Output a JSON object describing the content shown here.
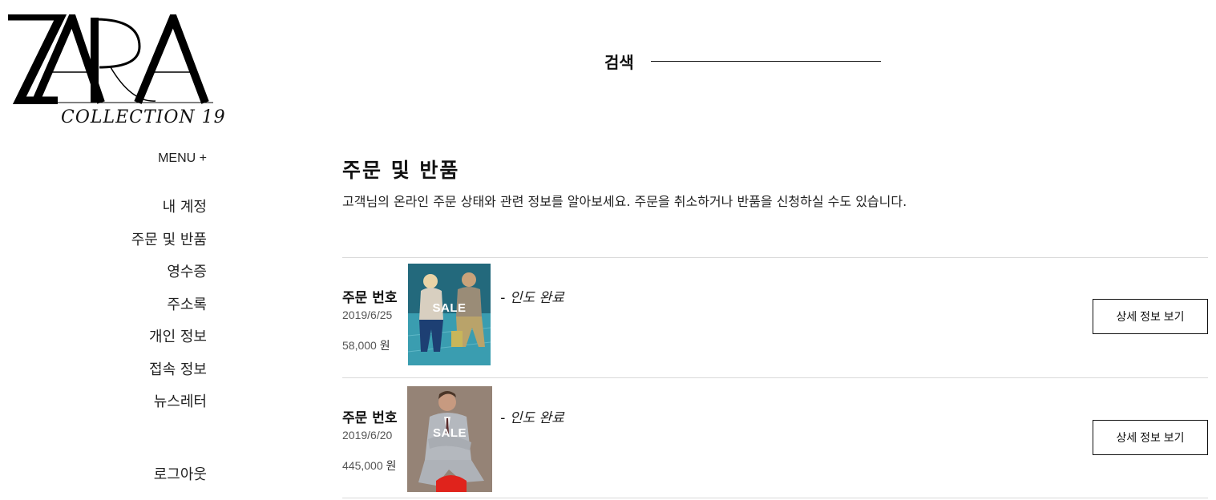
{
  "logo": {
    "text": "ZARA",
    "tagline": "COLLECTION 19"
  },
  "search": {
    "label": "검색"
  },
  "sidebar": {
    "menu_toggle": "MENU +",
    "items": [
      {
        "label": "내 계정"
      },
      {
        "label": "주문 및 반품"
      },
      {
        "label": "영수증"
      },
      {
        "label": "주소록"
      },
      {
        "label": "개인 정보"
      },
      {
        "label": "접속 정보"
      },
      {
        "label": "뉴스레터"
      }
    ],
    "logout": "로그아웃"
  },
  "main": {
    "title": "주문 및 반품",
    "description": "고객님의 온라인 주문 상태와 관련 정보를 알아보세요. 주문을 취소하거나 반품을 신청하실 수도 있습니다."
  },
  "orders": [
    {
      "number_label": "주문 번호",
      "status_separator": "-",
      "status": "인도 완료",
      "date": "2019/6/25",
      "price": "58,000",
      "currency": "원",
      "thumbnail_badge": "SALE",
      "detail_button": "상세 정보 보기"
    },
    {
      "number_label": "주문 번호",
      "status_separator": "-",
      "status": "인도 완료",
      "date": "2019/6/20",
      "price": "445,000",
      "currency": "원",
      "thumbnail_badge": "SALE",
      "detail_button": "상세 정보 보기"
    }
  ]
}
